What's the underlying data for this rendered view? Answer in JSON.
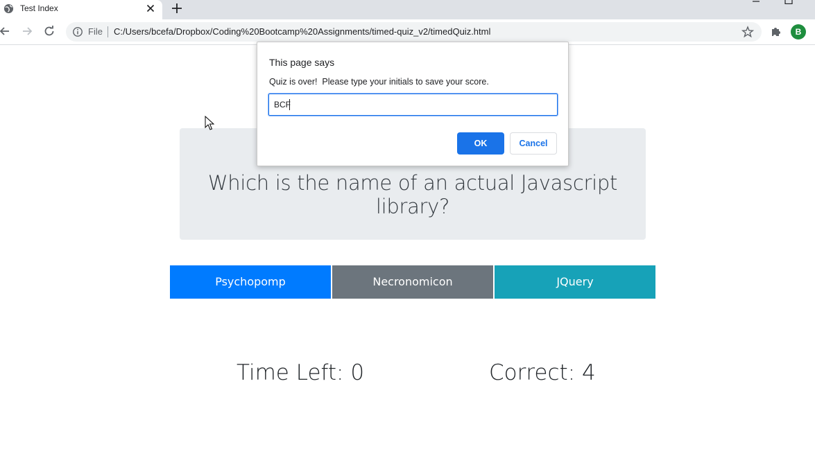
{
  "browser": {
    "tab_title": "Test Index",
    "scheme_label": "File",
    "url": "C:/Users/bcefa/Dropbox/Coding%20Bootcamp%20Assignments/timed-quiz_v2/timedQuiz.html",
    "avatar_initial": "B",
    "icons": {
      "favicon": "globe-icon",
      "tab_close": "close-icon",
      "new_tab": "plus-icon",
      "back": "arrow-left-icon",
      "forward": "arrow-right-icon",
      "reload": "reload-icon",
      "site_info": "info-icon",
      "bookmark": "star-icon",
      "extensions": "puzzle-icon"
    },
    "colors": {
      "avatar": "#1e8e3e",
      "accent": "#1a73e8"
    }
  },
  "dialog": {
    "title": "This page says",
    "message": "Quiz is over!  Please type your initials to save your score.",
    "input_value": "BCF",
    "ok_label": "OK",
    "cancel_label": "Cancel"
  },
  "quiz": {
    "question": "Which is the name of an actual Javascript library?",
    "answers": [
      {
        "label": "Psychopomp",
        "color": "#007bff"
      },
      {
        "label": "Necronomicon",
        "color": "#6c757d"
      },
      {
        "label": "JQuery",
        "color": "#17a2b8"
      }
    ],
    "time_left_text": "Time Left: 0",
    "correct_text": "Correct: 4"
  }
}
